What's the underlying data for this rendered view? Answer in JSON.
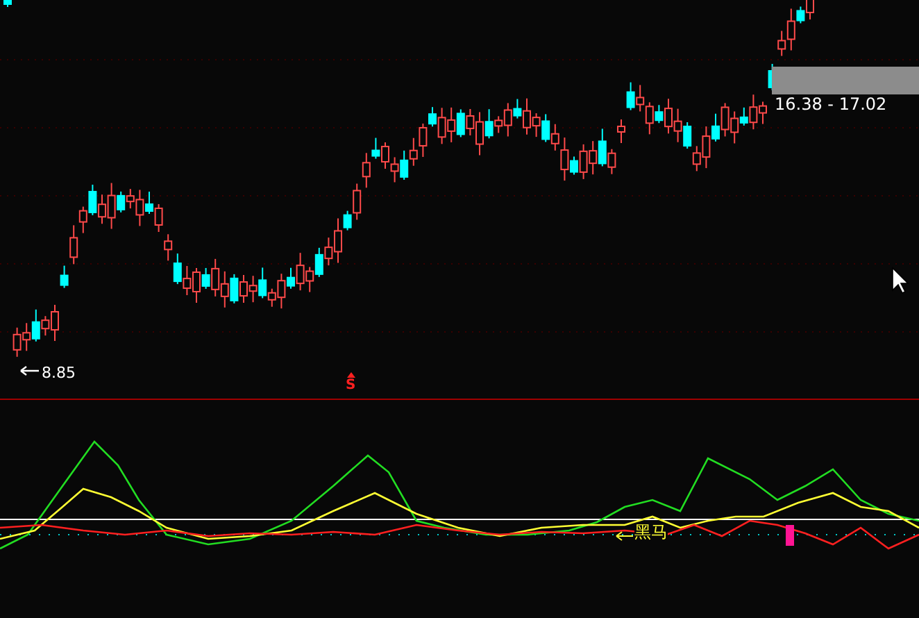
{
  "price_panel": {
    "range_label": "16.38 - 17.02",
    "low_label": "8.85",
    "signal_mark": "S"
  },
  "indicator_panel": {
    "signal_label": "黑马"
  }
}
